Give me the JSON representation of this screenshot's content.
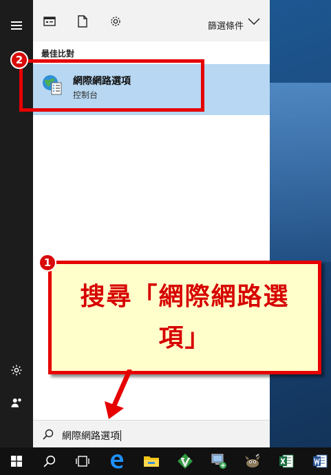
{
  "filter_bar": {
    "filters_label": "篩選條件",
    "icons": [
      "apps-icon",
      "documents-icon",
      "settings-icon"
    ]
  },
  "results": {
    "section_heading": "最佳比對",
    "best_match": {
      "title": "網際網路選項",
      "subtitle": "控制台",
      "icon": "internet-options-icon"
    }
  },
  "search": {
    "query": "網際網路選項"
  },
  "annotations": {
    "step1_number": "1",
    "step2_number": "2",
    "callout_text": "搜尋「網際網路選項」",
    "accent_color": "#e60000"
  },
  "taskbar": {
    "items": [
      "windows-start-icon",
      "search-icon",
      "task-view-icon",
      "edge-icon",
      "file-explorer-icon",
      "vim-icon",
      "network-icon",
      "gimp-icon",
      "excel-icon",
      "word-icon"
    ]
  }
}
